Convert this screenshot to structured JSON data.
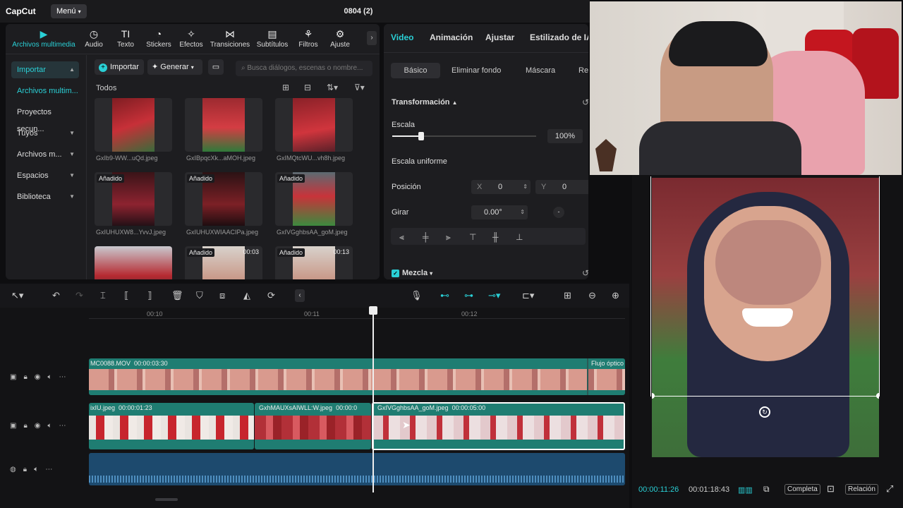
{
  "app": {
    "logo": "CapCut",
    "menu_label": "Menú",
    "doc_title": "0804 (2)"
  },
  "media_tools": [
    {
      "label": "Archivos multimedia",
      "icon": "media-icon",
      "glyph": "▶"
    },
    {
      "label": "Audio",
      "icon": "audio-icon",
      "glyph": "◷"
    },
    {
      "label": "Texto",
      "icon": "text-icon",
      "glyph": "TI"
    },
    {
      "label": "Stickers",
      "icon": "sticker-icon",
      "glyph": "◔"
    },
    {
      "label": "Efectos",
      "icon": "effects-icon",
      "glyph": "✧"
    },
    {
      "label": "Transiciones",
      "icon": "transitions-icon",
      "glyph": "⋈"
    },
    {
      "label": "Subtítulos",
      "icon": "subtitles-icon",
      "glyph": "▤"
    },
    {
      "label": "Filtros",
      "icon": "filters-icon",
      "glyph": "⚘"
    },
    {
      "label": "Ajuste",
      "icon": "adjust-icon",
      "glyph": "⚙"
    }
  ],
  "sidebar": [
    {
      "label": "Importar",
      "chevron": "▲"
    },
    {
      "label": "Archivos multim...",
      "chevron": ""
    },
    {
      "label": "Proyectos secun...",
      "chevron": ""
    },
    {
      "label": "Tuyos",
      "chevron": "▼"
    },
    {
      "label": "Archivos m...",
      "chevron": "▼"
    },
    {
      "label": "Espacios",
      "chevron": "▼"
    },
    {
      "label": "Biblioteca",
      "chevron": "▼"
    }
  ],
  "media_header": {
    "import_label": "Importar",
    "generate_label": "Generar",
    "search_placeholder": "Busca diálogos, escenas o nombre...",
    "filter_all": "Todos"
  },
  "media_items": [
    {
      "name": "GxIb9-WW...uQd.jpeg",
      "tag": "",
      "duration": ""
    },
    {
      "name": "GxIBpqcXk...aMOH.jpeg",
      "tag": "",
      "duration": ""
    },
    {
      "name": "GxIMQtcWU...vh8h.jpeg",
      "tag": "",
      "duration": ""
    },
    {
      "name": "GxIUHUXW8...YvvJ.jpeg",
      "tag": "Añadido",
      "duration": ""
    },
    {
      "name": "GxIUHUXWIAACIPa.jpeg",
      "tag": "Añadido",
      "duration": ""
    },
    {
      "name": "GxIVGghbsAA_goM.jpeg",
      "tag": "Añadido",
      "duration": ""
    },
    {
      "name": "",
      "tag": "",
      "duration": ""
    },
    {
      "name": "",
      "tag": "Añadido",
      "duration": "00:03"
    },
    {
      "name": "",
      "tag": "Añadido",
      "duration": "00:13"
    }
  ],
  "props": {
    "tabs": [
      "Video",
      "Animación",
      "Ajustar",
      "Estilizado de IA"
    ],
    "subtabs": [
      "Básico",
      "Eliminar fondo",
      "Máscara",
      "Re"
    ],
    "transform_label": "Transformación",
    "scale_label": "Escala",
    "scale_value": "100%",
    "scale_fraction": 0.2,
    "uniform_label": "Escala uniforme",
    "position_label": "Posición",
    "pos_x_label": "X",
    "pos_x": "0",
    "pos_y_label": "Y",
    "pos_y": "0",
    "rotate_label": "Girar",
    "rotate_value": "0.00°",
    "blend_label": "Mezcla"
  },
  "ruler": [
    "00:10",
    "00:11",
    "00:12"
  ],
  "tracks": {
    "main_clip": {
      "name": "MC0088.MOV",
      "duration": "00:00:03:30",
      "tag": "Flujo óptico"
    },
    "clips": [
      {
        "name": "ixIU.jpeg",
        "duration": "00:00:01:23"
      },
      {
        "name": "GxhMAUXsAIWLL:W.jpeg",
        "duration": "00:00:0"
      },
      {
        "name": "GxIVGghbsAA_goM.jpeg",
        "duration": "00:00:05:00"
      }
    ]
  },
  "player": {
    "current": "00:00:11:26",
    "total": "00:01:18:43",
    "full_label": "Completa",
    "ratio_label": "Relación"
  },
  "colors": {
    "accent": "#2ad0d6",
    "clip_teal": "#1f7d72",
    "audio_blue": "#1d4a6e"
  }
}
